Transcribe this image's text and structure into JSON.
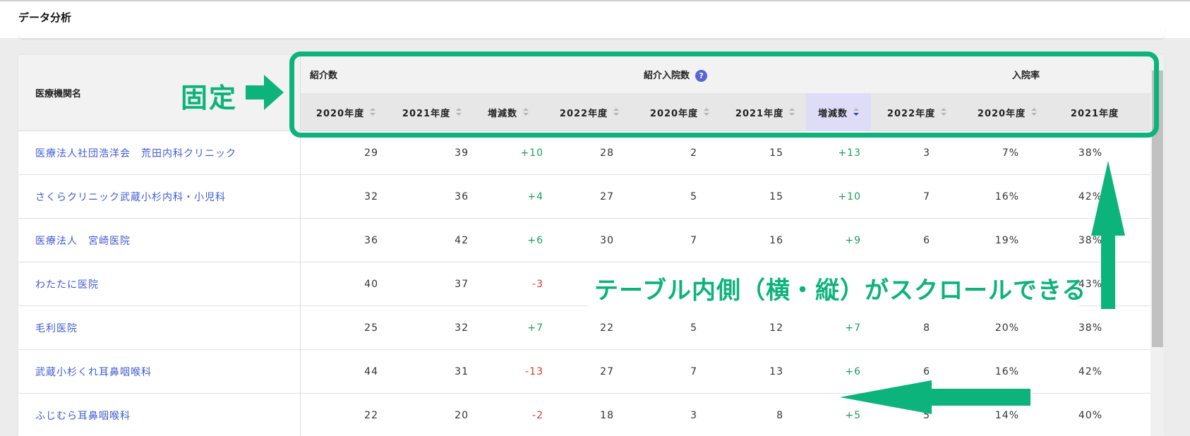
{
  "page": {
    "title": "データ分析"
  },
  "table": {
    "fixed_header": "医療機関名",
    "groups": [
      {
        "label": "紹介数",
        "help": false
      },
      {
        "label": "紹介入院数",
        "help": true
      },
      {
        "label": "入院率",
        "help": false
      }
    ],
    "columns": [
      {
        "label": "2020年度",
        "sort": "none"
      },
      {
        "label": "2021年度",
        "sort": "none"
      },
      {
        "label": "増減数",
        "sort": "none"
      },
      {
        "label": "2022年度",
        "sort": "none"
      },
      {
        "label": "2020年度",
        "sort": "none"
      },
      {
        "label": "2021年度",
        "sort": "none"
      },
      {
        "label": "増減数",
        "sort": "desc"
      },
      {
        "label": "2022年度",
        "sort": "none"
      },
      {
        "label": "2020年度",
        "sort": "none"
      },
      {
        "label": "2021年度",
        "sort": "none"
      }
    ],
    "rows": [
      {
        "name": "医療法人社団浩洋会　荒田内科クリニック",
        "values": [
          "29",
          "39",
          "+10",
          "28",
          "2",
          "15",
          "+13",
          "3",
          "7%",
          "38%"
        ]
      },
      {
        "name": "さくらクリニック武蔵小杉内科・小児科",
        "values": [
          "32",
          "36",
          "+4",
          "27",
          "5",
          "15",
          "+10",
          "7",
          "16%",
          "42%"
        ]
      },
      {
        "name": "医療法人　宮崎医院",
        "values": [
          "36",
          "42",
          "+6",
          "30",
          "7",
          "16",
          "+9",
          "6",
          "19%",
          "38%"
        ]
      },
      {
        "name": "わたたに医院",
        "values": [
          "40",
          "37",
          "-3",
          "",
          "",
          "",
          "",
          "",
          "",
          "43%"
        ]
      },
      {
        "name": "毛利医院",
        "values": [
          "25",
          "32",
          "+7",
          "22",
          "5",
          "12",
          "+7",
          "8",
          "20%",
          "38%"
        ]
      },
      {
        "name": "武蔵小杉くれ耳鼻咽喉科",
        "values": [
          "44",
          "31",
          "-13",
          "27",
          "7",
          "13",
          "+6",
          "6",
          "16%",
          "42%"
        ]
      },
      {
        "name": "ふじむら耳鼻咽喉科",
        "values": [
          "22",
          "20",
          "-2",
          "18",
          "3",
          "8",
          "+5",
          "5",
          "14%",
          "40%"
        ]
      }
    ]
  },
  "annotations": {
    "fixed_label": "固定",
    "scroll_label": "テーブル内側（横・縦）がスクロールできる"
  },
  "colors": {
    "accent": "#0cb37a",
    "link": "#3f5bd6",
    "positive": "#1e9e5a",
    "negative": "#d23a2e",
    "help_icon": "#5a63d6"
  }
}
